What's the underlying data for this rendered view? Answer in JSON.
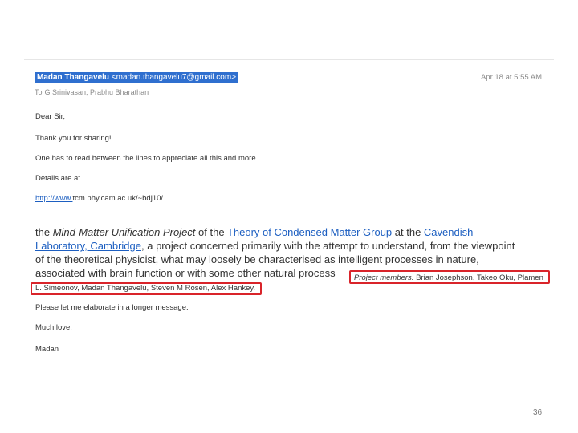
{
  "email": {
    "sender_name": "Madan Thangavelu",
    "sender_email": "<madan.thangavelu7@gmail.com>",
    "date": "Apr 18 at 5:55 AM",
    "to_prefix": "To",
    "recipients": "G Srinivasan, Prabhu Bharathan",
    "greeting": "Dear Sir,",
    "line1": "Thank you for sharing!",
    "line2": "One has to read between the lines to appreciate all this and more",
    "line3": "Details are at",
    "url_part1": "http://www.",
    "url_part2": "tcm.phy.cam.ac.uk/~bdj10/",
    "quote": {
      "the": "the ",
      "project_name": "Mind-Matter Unification Project",
      "of_the": " of the ",
      "tcm_link": "Theory of Condensed Matter Group",
      "at_the": " at the ",
      "cav_link_1": "Cavendish",
      "cav_link_2": "Laboratory, Cambridge",
      "rest_1": ", a project concerned primarily with the attempt to understand, from the viewpoint",
      "rest_2": "of the theoretical physicist, what may loosely be characterised as intelligent processes in nature,",
      "rest_3": "associated with brain function or with some other natural process",
      "members_label": "Project members:",
      "members_1": " Brian Josephson, Takeo Oku, Plamen",
      "members_2": "L. Simeonov, Madan Thangavelu, Steven M Rosen, Alex Hankey."
    },
    "line4": "Please let me elaborate in a longer message.",
    "signoff": "Much love,",
    "signature": "Madan"
  },
  "slide": {
    "page_number": "36"
  },
  "colors": {
    "highlight": "#2f6fcf",
    "link": "#1d5fc1",
    "box": "#d9242a"
  }
}
